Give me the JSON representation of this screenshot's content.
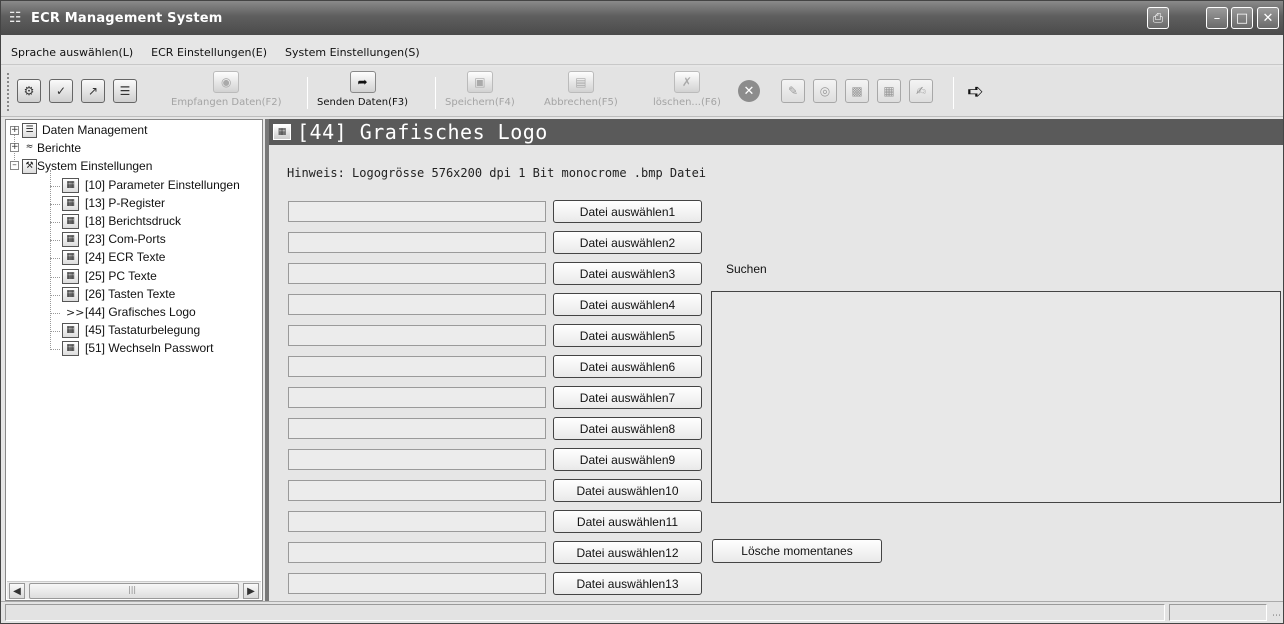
{
  "window": {
    "title": "ECR Management System"
  },
  "menu": {
    "items": [
      "Sprache auswählen(L)",
      "ECR Einstellungen(E)",
      "System Einstellungen(S)"
    ]
  },
  "toolbar": {
    "receive_label": "Empfangen Daten(F2)",
    "send_label": "Senden Daten(F3)",
    "save_label": "Speichern(F4)",
    "cancel_label": "Abbrechen(F5)",
    "delete_label": "löschen...(F6)"
  },
  "tree": {
    "data_management": "Daten Management",
    "reports": "Berichte",
    "system_settings": "System Einstellungen",
    "children": [
      "[10] Parameter Einstellungen",
      "[13] P-Register",
      "[18] Berichtsdruck",
      "[23] Com-Ports",
      "[24] ECR Texte",
      "[25] PC Texte",
      "[26] Tasten Texte",
      "[44] Grafisches Logo",
      "[45] Tastaturbelegung",
      "[51] Wechseln Passwort"
    ],
    "selected_marker": ">>"
  },
  "content": {
    "header_title": "[44] Grafisches Logo",
    "hint": "Hinweis: Logogrösse 576x200 dpi 1 Bit monocrome .bmp Datei",
    "file_buttons": [
      "Datei auswählen1",
      "Datei auswählen2",
      "Datei auswählen3",
      "Datei auswählen4",
      "Datei auswählen5",
      "Datei auswählen6",
      "Datei auswählen7",
      "Datei auswählen8",
      "Datei auswählen9",
      "Datei auswählen10",
      "Datei auswählen11",
      "Datei auswählen12",
      "Datei auswählen13"
    ],
    "search_label": "Suchen",
    "delete_current_label": "Lösche momentanes"
  },
  "icons": {
    "app": "cash-register-icon",
    "print": "printer-icon",
    "exit": "exit-door-icon"
  },
  "colors": {
    "title_bar": "#5e5e5e",
    "content_header": "#5a5a5a",
    "background": "#e6e6e6"
  }
}
